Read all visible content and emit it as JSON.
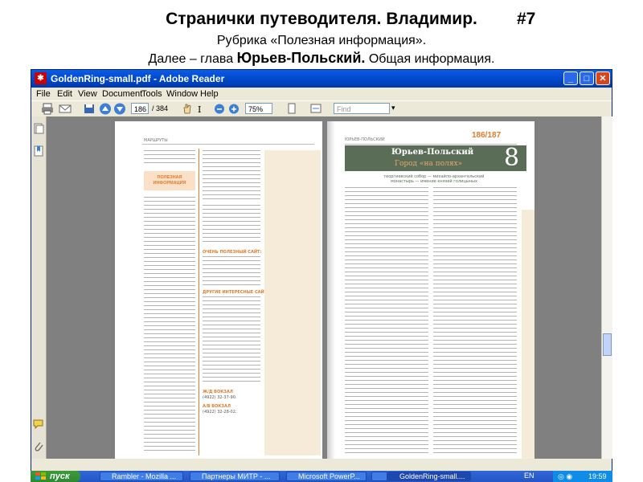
{
  "slide": {
    "title": "Странички путеводителя. Владимир.",
    "number": "#7",
    "subtitle": "Рубрика «Полезная информация».",
    "line3_prefix": "Далее – глава ",
    "line3_bold": "Юрьев-Польский.",
    "line3_suffix": " Общая информация."
  },
  "window": {
    "title": "GoldenRing-small.pdf - Adobe Reader",
    "menu": [
      "File",
      "Edit",
      "View",
      "Document",
      "Tools",
      "Window",
      "Help"
    ],
    "toolbar": {
      "page_current": "186",
      "page_total": "/ 384",
      "zoom": "75%",
      "find_placeholder": "Find"
    }
  },
  "pages": {
    "left_header": "МАРШРУТЫ",
    "left_sidebar_title": "ПОЛЕЗНАЯ ИНФОРМАЦИЯ",
    "left_section_useful_site": "ОЧЕНЬ ПОЛЕЗНЫЙ САЙТ:",
    "left_section_other_sites": "ДРУГИЕ ИНТЕРЕСНЫЕ САЙТЫ:",
    "left_section_station": "Ж/Д ВОКЗАЛ",
    "left_section_station_phone": "(4922) 32-37-90.",
    "left_section_bus": "А/В ВОКЗАЛ",
    "left_section_bus_phone": "(4922) 32-28-02.",
    "right_header": "ЮРЬЕВ-ПОЛЬСКИЙ",
    "right_page_numbers": "186/187",
    "right_chapter_title": "Юрьев-Польский",
    "right_chapter_subtitle": "Город «на полях»",
    "right_chapter_number": "8",
    "right_chapter_note": "георгиевский собор — михайло-архангельский монастырь — имение князей голицыных"
  },
  "taskbar": {
    "start": "пуск",
    "tasks": [
      "Rambler - Mozilla ...",
      "Партнеры МИТР - ...",
      "Microsoft PowerP...",
      "",
      "GoldenRing-small...."
    ],
    "lang": "EN",
    "clock": "19:59"
  },
  "colors": {
    "accent_orange": "#e07b2a",
    "chapter_green": "#5a6e57",
    "titlebar_blue": "#0054e3"
  }
}
